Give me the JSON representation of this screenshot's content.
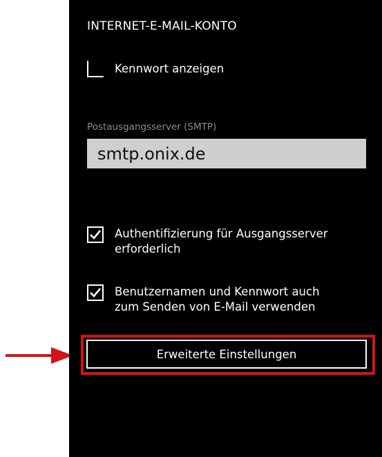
{
  "header": {
    "title": "INTERNET-E-MAIL-KONTO"
  },
  "show_password": {
    "label": "Kennwort anzeigen",
    "checked": false
  },
  "smtp": {
    "label": "Postausgangsserver (SMTP)",
    "value": "smtp.onix.de"
  },
  "auth_required": {
    "label_line1": "Authentifizierung für Ausgangsserver",
    "label_line2": "erforderlich",
    "checked": true
  },
  "use_credentials": {
    "label_line1": "Benutzernamen und Kennwort auch",
    "label_line2": "zum Senden von E-Mail verwenden",
    "checked": true
  },
  "advanced_button": {
    "label": "Erweiterte Einstellungen"
  },
  "colors": {
    "screen_background": "#000000",
    "highlight": "#d01418",
    "input_background": "#cfcfcf",
    "field_label": "#8c8c8c"
  },
  "icons": {
    "annotation_arrow": "arrow-right-icon",
    "checked": "checkmark-icon"
  }
}
